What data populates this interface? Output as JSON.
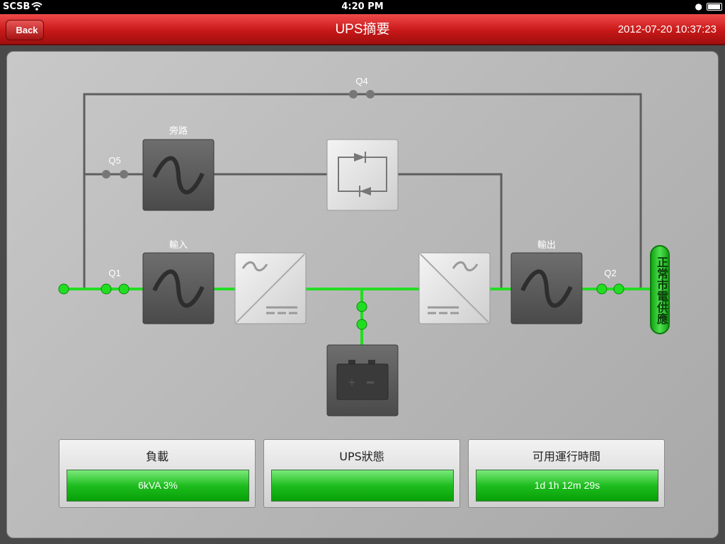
{
  "status_bar": {
    "carrier": "SCSB",
    "time": "4:20 PM"
  },
  "nav": {
    "back_label": "Back",
    "title": "UPS摘要",
    "datetime": "2012-07-20 10:37:23"
  },
  "diagram": {
    "labels": {
      "q4": "Q4",
      "q5": "Q5",
      "q1": "Q1",
      "q2": "Q2",
      "bypass": "旁路",
      "input": "輸入",
      "output": "輸出"
    },
    "output_status": "正常市電供應",
    "colors": {
      "active_line": "#22dd22",
      "inactive_line": "#666666"
    }
  },
  "info": {
    "load": {
      "title": "負載",
      "value": "6kVA  3%"
    },
    "ups_status": {
      "title": "UPS狀態",
      "value": ""
    },
    "runtime": {
      "title": "可用運行時間",
      "value": "1d 1h 12m 29s"
    }
  }
}
